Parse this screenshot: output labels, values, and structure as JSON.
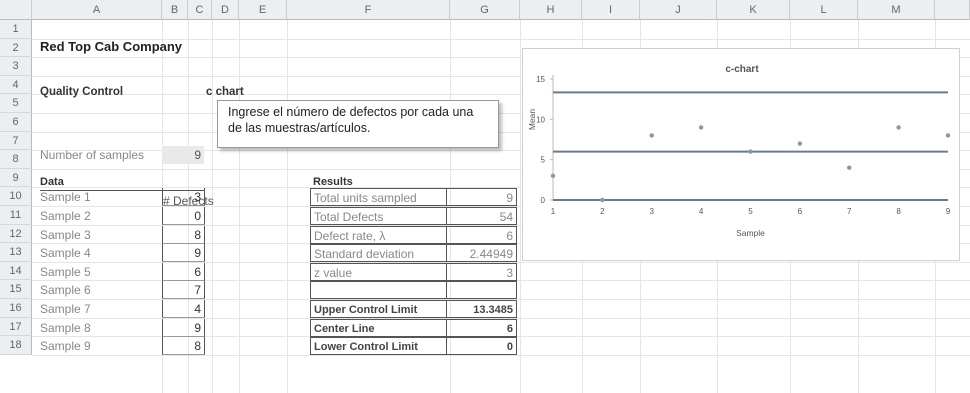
{
  "columns": [
    "A",
    "B",
    "C",
    "D",
    "E",
    "F",
    "G",
    "H",
    "I",
    "J",
    "K",
    "L",
    "M"
  ],
  "rows": [
    "1",
    "2",
    "3",
    "4",
    "5",
    "6",
    "7",
    "8",
    "9",
    "10",
    "11",
    "12",
    "13",
    "14",
    "15",
    "16",
    "17",
    "18"
  ],
  "sheet": {
    "title": "Red Top Cab Company",
    "section": "Quality Control",
    "chart_type_label": "c chart",
    "samples_label": "Number of samples",
    "samples_value": "9",
    "data_label": "Data",
    "defects_header": "# Defects",
    "samples": [
      {
        "label": "Sample 1",
        "value": "3"
      },
      {
        "label": "Sample 2",
        "value": "0"
      },
      {
        "label": "Sample 3",
        "value": "8"
      },
      {
        "label": "Sample 4",
        "value": "9"
      },
      {
        "label": "Sample 5",
        "value": "6"
      },
      {
        "label": "Sample 6",
        "value": "7"
      },
      {
        "label": "Sample 7",
        "value": "4"
      },
      {
        "label": "Sample 8",
        "value": "9"
      },
      {
        "label": "Sample 9",
        "value": "8"
      }
    ],
    "results_label": "Results",
    "results": [
      {
        "label": "Total units sampled",
        "value": "9"
      },
      {
        "label": "Total Defects",
        "value": "54"
      },
      {
        "label": "Defect rate, λ",
        "value": "6"
      },
      {
        "label": "Standard deviation",
        "value": "2.44949"
      },
      {
        "label": "z value",
        "value": "3"
      },
      {
        "label": "",
        "value": ""
      }
    ],
    "limits": [
      {
        "label": "Upper Control Limit",
        "value": "13.3485"
      },
      {
        "label": "Center Line",
        "value": "6"
      },
      {
        "label": "Lower Control Limit",
        "value": "0"
      }
    ]
  },
  "callout": {
    "text": "Ingrese el número de defectos por cada una de las muestras/artículos."
  },
  "chart_data": {
    "type": "scatter",
    "title": "c-chart",
    "xlabel": "Sample",
    "ylabel": "Mean",
    "x": [
      1,
      2,
      3,
      4,
      5,
      6,
      7,
      8,
      9
    ],
    "series": [
      {
        "values": [
          3,
          0,
          8,
          9,
          6,
          7,
          4,
          9,
          8
        ]
      }
    ],
    "lines": [
      13.3485,
      6,
      0
    ],
    "xlim": [
      1,
      9
    ],
    "ylim": [
      0,
      15
    ],
    "yticks": [
      "0",
      "5",
      "10",
      "15"
    ],
    "xticks": [
      "1",
      "2",
      "3",
      "4",
      "5",
      "6",
      "7",
      "8",
      "9"
    ],
    "colors": {
      "line": "#6d7a8c",
      "point": "#8a97a8"
    }
  }
}
